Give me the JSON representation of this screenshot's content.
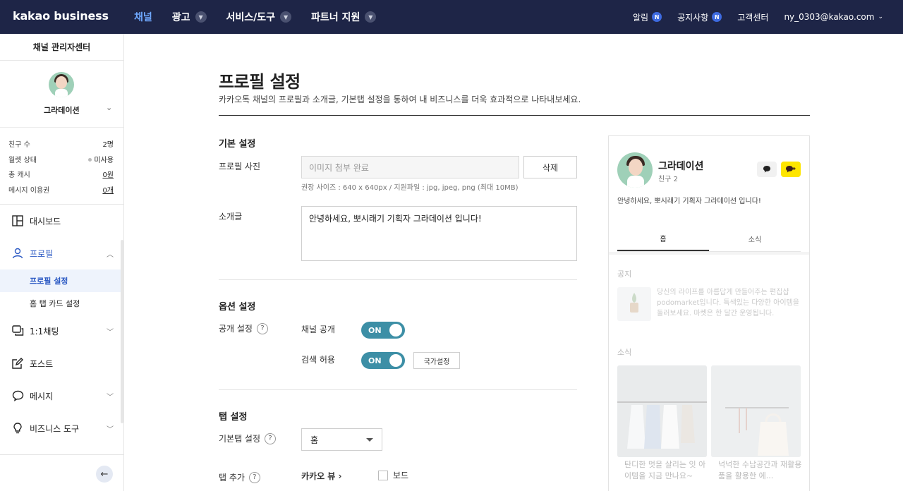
{
  "topbar": {
    "logo": "kakao business",
    "nav": [
      {
        "label": "채널",
        "active": true,
        "dropdown": false
      },
      {
        "label": "광고",
        "active": false,
        "dropdown": true
      },
      {
        "label": "서비스/도구",
        "active": false,
        "dropdown": true
      },
      {
        "label": "파트너 지원",
        "active": false,
        "dropdown": true
      }
    ],
    "util": {
      "alarm": "알림",
      "notice": "공지사항",
      "badge": "N",
      "support": "고객센터",
      "account": "ny_0303@kakao.com"
    }
  },
  "sidebar": {
    "title": "채널 관리자센터",
    "channel_name": "그라데이션",
    "stats": [
      {
        "label": "친구 수",
        "value": "2명"
      },
      {
        "label": "월렛 상태",
        "value": "미사용"
      },
      {
        "label": "총 캐시",
        "value": "0원"
      },
      {
        "label": "메시지 이용권",
        "value": "0개"
      }
    ],
    "menu": {
      "dashboard": "대시보드",
      "profile": "프로필",
      "profile_settings": "프로필 설정",
      "home_tab_card": "홈 탭 카드 설정",
      "chat": "1:1채팅",
      "post": "포스트",
      "message": "메시지",
      "biz_tools": "비즈니스 도구"
    }
  },
  "main": {
    "title": "프로필 설정",
    "description": "카카오톡 채널의 프로필과 소개글, 기본탭 설정을 통하여 내 비즈니스를 더욱 효과적으로 나타내보세요.",
    "basic": {
      "section_title": "기본 설정",
      "photo_label": "프로필 사진",
      "photo_value": "이미지 첨부 완료",
      "delete_button": "삭제",
      "photo_hint": "권장 사이즈 : 640 x 640px / 지원파일 : jpg, jpeg, png (최대 10MB)",
      "intro_label": "소개글",
      "intro_value": "안녕하세요, 뽀시래기 기획자 그라데이션 입니다!"
    },
    "options": {
      "section_title": "옵션 설정",
      "public_label": "공개 설정",
      "qmark": "?",
      "channel_public": "채널 공개",
      "search_allow": "검색 허용",
      "toggle_on": "ON",
      "country_button": "국가설정"
    },
    "tabs": {
      "section_title": "탭 설정",
      "default_tab_label": "기본탭 설정",
      "default_tab_value": "홈",
      "tab_add_label": "탭 추가",
      "kakao_view": "카카오 뷰 ›",
      "board": "보드"
    }
  },
  "preview": {
    "name": "그라데이션",
    "friends": "친구 2",
    "intro": "안녕하세요, 뽀시래기 기획자 그라데이션 입니다!",
    "tab_home": "홈",
    "tab_news": "소식",
    "notice_title": "공지",
    "notice_text": "당신의 라이프를 아름답게 만들어주는 편집샵 podomarket입니다. 특색있는 다양한 아이템을 둘러보세요. 마켓은 한 달간 운영됩니다.",
    "news_title": "소식",
    "cards": [
      {
        "text": "탄디한 멋을 살리는 잇 아이템을 지금 만나요~"
      },
      {
        "text": "넉넉한 수납공간과 재활용품을 활용한 에..."
      }
    ]
  },
  "colors": {
    "topbar_bg": "#1e2547",
    "nav_active": "#6fa8ff",
    "toggle_on": "#3d8fa6",
    "kakao_yellow": "#fee500",
    "badge_blue": "#3d6ae0"
  }
}
